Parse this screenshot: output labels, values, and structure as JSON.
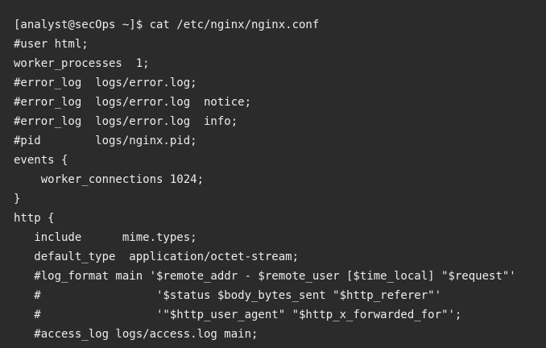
{
  "terminal": {
    "lines": [
      "[analyst@secOps ~]$ cat /etc/nginx/nginx.conf",
      "#user html;",
      "worker_processes  1;",
      "#error_log  logs/error.log;",
      "#error_log  logs/error.log  notice;",
      "#error_log  logs/error.log  info;",
      "#pid        logs/nginx.pid;",
      "events {",
      "    worker_connections 1024;",
      "}",
      "http {",
      "   include      mime.types;",
      "   default_type  application/octet-stream;",
      "   #log_format main '$remote_addr - $remote_user [$time_local] \"$request\"'",
      "   #                 '$status $body_bytes_sent \"$http_referer\"'",
      "   #                 '\"$http_user_agent\" \"$http_x_forwarded_for\"';",
      "   #access_log logs/access.log main;"
    ]
  }
}
